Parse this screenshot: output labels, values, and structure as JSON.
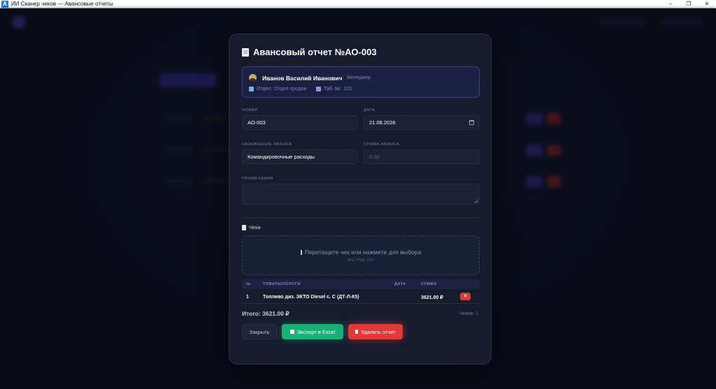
{
  "window": {
    "title": "ИИ Сканер чеков — Авансовые отчеты",
    "app_icon_letter": "A",
    "minimize": "–",
    "maximize": "❐",
    "close": "✕"
  },
  "modal": {
    "title": "Авансовый отчет №АО-003",
    "employee": {
      "name": "Иванов Василий Иванович",
      "role": "Менеджер",
      "department_label": "Отдел:",
      "department": "Отдел продаж",
      "tab_label": "Таб. №:",
      "tab_number": "123"
    },
    "fields": {
      "number_label": "НОМЕР",
      "number_value": "АО-003",
      "date_label": "ДАТА",
      "date_value": "21.08.2026",
      "purpose_label": "НАЗНАЧЕНИЕ АВАНСА",
      "purpose_value": "Командировочные расходы",
      "amount_label": "СУММА АВАНСА",
      "amount_placeholder": "0.00",
      "notes_label": "ПРИМЕЧАНИЯ"
    },
    "receipts": {
      "section_title": "Чеки",
      "dropzone_text": "Перетащите чек или нажмите для выбора",
      "dropzone_formats": "JPG, PNG, PDF",
      "columns": [
        "№",
        "ТОВАРЫ/УСЛУГИ",
        "ДАТА",
        "СУММА"
      ],
      "rows": [
        {
          "num": "1",
          "item": "Топливо диз. ЭКТО Diesel с. С (ДТ-Л-К5)",
          "date": "",
          "sum": "3621.00 ₽",
          "delete": "✕"
        }
      ]
    },
    "total": "Итого: 3621.00 ₽",
    "receipts_count": "Чеков: 1",
    "buttons": {
      "close": "Закрыть",
      "export": "Экспорт в Excel",
      "delete": "Удалить отчет"
    }
  },
  "colors": {
    "accent": "#5b4bd8",
    "success": "#19b07a",
    "danger": "#e03a3a",
    "background": "#0b0e1c",
    "modal": "#161c2e"
  }
}
